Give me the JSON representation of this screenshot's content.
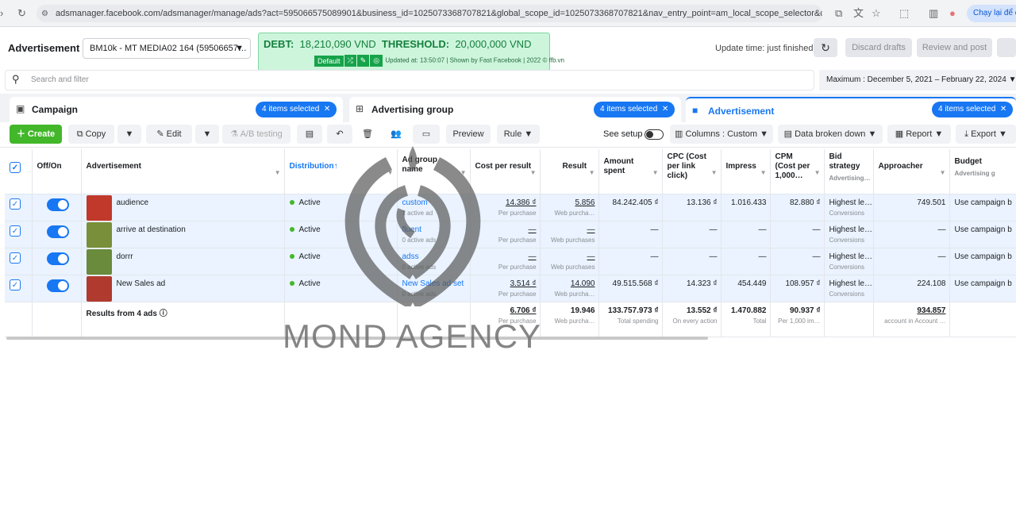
{
  "browser": {
    "url": "adsmanager.facebook.com/adsmanager/manage/ads?act=595066575089901&business_id=1025073368707821&global_scope_id=1025073368707821&nav_entry_point=am_local_scope_selector&columns=name%2Cdeli…",
    "relaunch": "Chạy lại để c"
  },
  "header": {
    "title": "Advertisement",
    "account": "BM10k - MT MEDIA02 164 (59506657…",
    "update_time": "Update time: just finished",
    "discard": "Discard drafts",
    "review": "Review and post"
  },
  "debt": {
    "debt_label": "DEBT:",
    "debt_value": "18,210,090 VND",
    "threshold_label": "THRESHOLD:",
    "threshold_value": "20,000,000 VND",
    "default_btn": "Default",
    "updated": "Updated at: 13:50:07 | Shown by Fast Facebook | 2022 © ffb.vn"
  },
  "search": {
    "placeholder": "Search and filter"
  },
  "daterange": "Maximum : December 5, 2021 – February 22, 2024",
  "tabs": [
    {
      "label": "Campaign",
      "selected": "4 items selected"
    },
    {
      "label": "Advertising group",
      "selected": "4 items selected"
    },
    {
      "label": "Advertisement",
      "selected": "4 items selected"
    }
  ],
  "toolbar": {
    "create": "Create",
    "copy": "Copy",
    "edit": "Edit",
    "ab": "A/B testing",
    "preview": "Preview",
    "rule": "Rule",
    "see_setup": "See setup",
    "columns": "Columns : Custom",
    "breakdown": "Data broken down",
    "report": "Report",
    "export": "Export"
  },
  "columns": [
    "Off/On",
    "Advertisement",
    "Distribution",
    "Ad group name",
    "Cost per result",
    "Result",
    "Amount spent",
    "CPC (Cost per link click)",
    "Impress",
    "CPM (Cost per 1,000…",
    "Bid strategy",
    "Approacher",
    "Budget"
  ],
  "col_subs": {
    "bid": "Advertising…",
    "budget": "Advertising g"
  },
  "rows": [
    {
      "name": "audience",
      "status": "Active",
      "group": "custom",
      "group_sub": "1 active ad",
      "cpr": "14.386 ₫",
      "cpr_sub": "Per purchase",
      "result": "5.856",
      "result_sub": "Web purcha…",
      "spent": "84.242.405 ₫",
      "cpc": "13.136 ₫",
      "impress": "1.016.433",
      "cpm": "82.880 ₫",
      "bid": "Highest le…",
      "bid_sub": "Conversions",
      "approacher": "749.501",
      "budget": "Use campaign b"
    },
    {
      "name": "arrive at destination",
      "status": "Active",
      "group": "fluent",
      "group_sub": "0 active ads",
      "cpr": "—",
      "cpr_sub": "Per purchase",
      "result": "—",
      "result_sub": "Web purchases",
      "spent": "—",
      "cpc": "—",
      "impress": "—",
      "cpm": "—",
      "bid": "Highest le…",
      "bid_sub": "Conversions",
      "approacher": "—",
      "budget": "Use campaign b"
    },
    {
      "name": "dorrr",
      "status": "Active",
      "group": "adss",
      "group_sub": "0 active ads",
      "cpr": "—",
      "cpr_sub": "Per purchase",
      "result": "—",
      "result_sub": "Web purchases",
      "spent": "—",
      "cpc": "—",
      "impress": "—",
      "cpm": "—",
      "bid": "Highest le…",
      "bid_sub": "Conversions",
      "approacher": "—",
      "budget": "Use campaign b"
    },
    {
      "name": "New Sales ad",
      "status": "Active",
      "group": "New Sales ad set",
      "group_sub": "0 active ads",
      "cpr": "3.514 ₫",
      "cpr_sub": "Per purchase",
      "result": "14.090",
      "result_sub": "Web purcha…",
      "spent": "49.515.568 ₫",
      "cpc": "14.323 ₫",
      "impress": "454.449",
      "cpm": "108.957 ₫",
      "bid": "Highest le…",
      "bid_sub": "Conversions",
      "approacher": "224.108",
      "budget": "Use campaign b"
    }
  ],
  "totals": {
    "label": "Results from 4 ads",
    "cpr": "6.706 ₫",
    "cpr_sub": "Per purchase",
    "result": "19.946",
    "result_sub": "Web purcha…",
    "spent": "133.757.973 ₫",
    "spent_sub": "Total spending",
    "cpc": "13.552 ₫",
    "cpc_sub": "On every action",
    "impress": "1.470.882",
    "impress_sub": "Total",
    "cpm": "90.937 ₫",
    "cpm_sub": "Per 1,000 im…",
    "approacher": "934.857",
    "approacher_sub": "account in Account …"
  },
  "watermark": "MOND AGENCY",
  "colors": {
    "accent": "#1877f2",
    "create": "#42b72a",
    "debt_bg": "#cdf5dc"
  }
}
